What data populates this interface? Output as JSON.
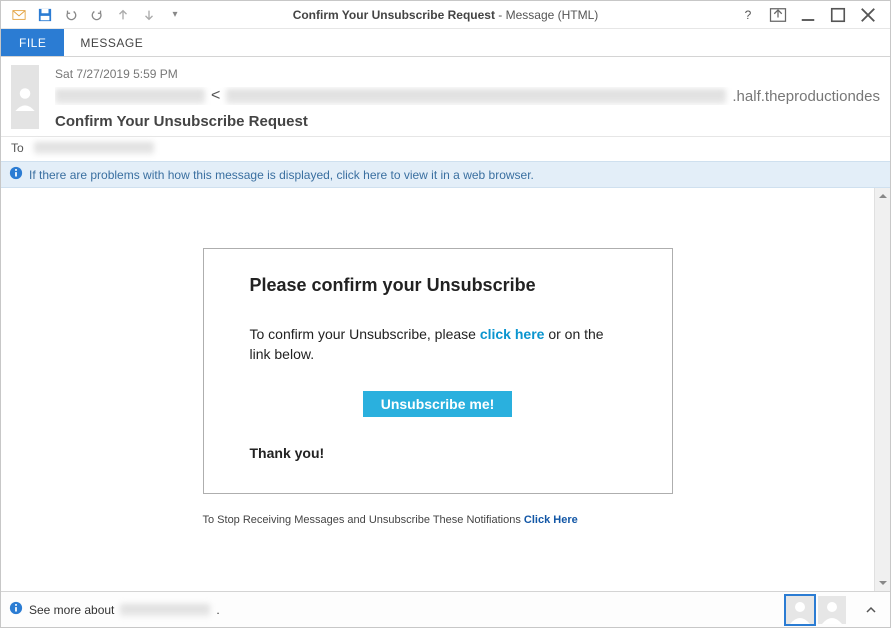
{
  "title": {
    "bold": "Confirm Your Unsubscribe Request",
    "suffix": " - Message (HTML)"
  },
  "tabs": {
    "file": "FILE",
    "message": "MESSAGE"
  },
  "header": {
    "date": "Sat 7/27/2019 5:59 PM",
    "from_domain_visible": ".half.theproductiondes",
    "subject": "Confirm Your Unsubscribe Request",
    "to_label": "To"
  },
  "infobar": {
    "text": "If there are problems with how this message is displayed, click here to view it in a web browser."
  },
  "email": {
    "heading": "Please confirm your Unsubscribe",
    "line_prefix": "To confirm your Unsubscribe, please ",
    "line_link": "click here",
    "line_suffix": " or on the link below.",
    "button": "Unsubscribe me!",
    "thankyou": "Thank you!",
    "footer_text": "To Stop Receiving Messages and Unsubscribe These Notifiations ",
    "footer_link": "Click Here"
  },
  "status": {
    "see_more_prefix": "See more about ",
    "see_more_suffix": "."
  }
}
